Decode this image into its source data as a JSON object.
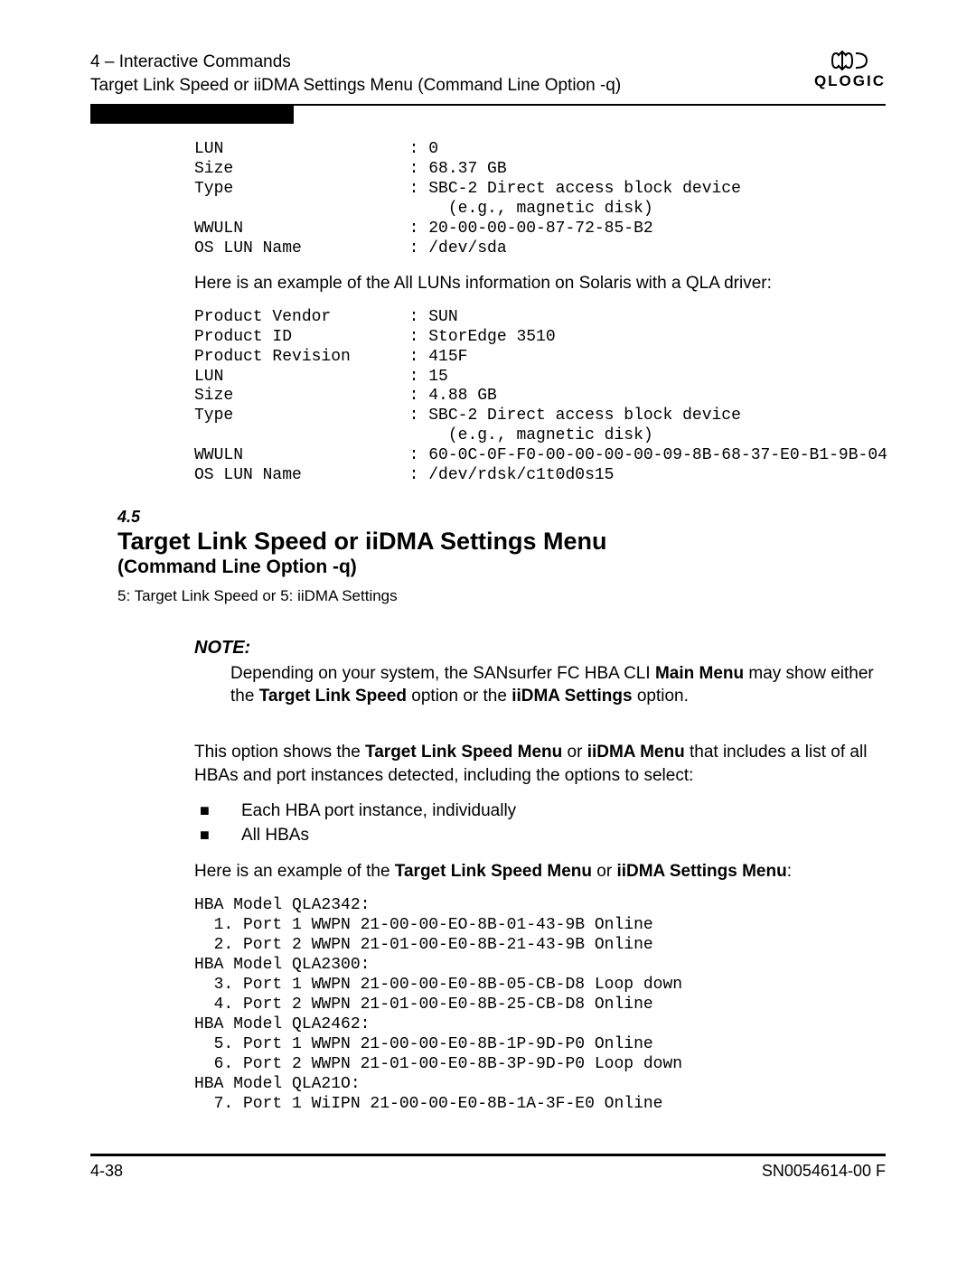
{
  "header": {
    "chapter": "4 – Interactive Commands",
    "subtitle": "Target Link Speed or iiDMA Settings Menu (Command Line Option -q)",
    "brand": "QLOGIC"
  },
  "block1": {
    "lines": "LUN                   : 0\nSize                  : 68.37 GB\nType                  : SBC-2 Direct access block device\n                          (e.g., magnetic disk)\nWWULN                 : 20-00-00-00-87-72-85-B2\nOS LUN Name           : /dev/sda"
  },
  "para1": "Here is an example of the All LUNs information on Solaris with a QLA driver:",
  "block2": {
    "lines": "Product Vendor        : SUN\nProduct ID            : StorEdge 3510\nProduct Revision      : 415F\nLUN                   : 15\nSize                  : 4.88 GB\nType                  : SBC-2 Direct access block device\n                          (e.g., magnetic disk)\nWWULN                 : 60-0C-0F-F0-00-00-00-00-09-8B-68-37-E0-B1-9B-04\nOS LUN Name           : /dev/rdsk/c1t0d0s15"
  },
  "section": {
    "num": "4.5",
    "title": "Target Link Speed or iiDMA Settings Menu",
    "sub": "(Command Line Option -q)",
    "desc": "5: Target Link Speed or 5: iiDMA Settings"
  },
  "note": {
    "label": "NOTE:",
    "t1": "Depending on your system, the SANsurfer FC HBA CLI ",
    "b1": "Main Menu",
    "t2": " may show either the ",
    "b2": "Target Link Speed",
    "t3": " option or the ",
    "b3": "iiDMA Settings",
    "t4": " option."
  },
  "para2": {
    "t1": "This option shows the ",
    "b1": "Target Link Speed Menu",
    "t2": " or ",
    "b2": "iiDMA Menu",
    "t3": " that includes a list of all HBAs and port instances detected, including the options to select:"
  },
  "bullets": {
    "i1": "Each HBA port instance, individually",
    "i2": "All HBAs"
  },
  "para3": {
    "t1": "Here is an example of the ",
    "b1": "Target Link Speed Menu",
    "t2": " or ",
    "b2": "iiDMA Settings Menu",
    "t3": ":"
  },
  "block3": {
    "lines": "HBA Model QLA2342:\n  1. Port 1 WWPN 21-00-00-EO-8B-01-43-9B Online\n  2. Port 2 WWPN 21-01-00-E0-8B-21-43-9B Online\nHBA Model QLA2300:\n  3. Port 1 WWPN 21-00-00-E0-8B-05-CB-D8 Loop down\n  4. Port 2 WWPN 21-01-00-E0-8B-25-CB-D8 Online\nHBA Model QLA2462:\n  5. Port 1 WWPN 21-00-00-E0-8B-1P-9D-P0 Online\n  6. Port 2 WWPN 21-01-00-E0-8B-3P-9D-P0 Loop down\nHBA Model QLA21O:\n  7. Port 1 WiIPN 21-00-00-E0-8B-1A-3F-E0 Online"
  },
  "footer": {
    "left": "4-38",
    "right": "SN0054614-00  F"
  }
}
